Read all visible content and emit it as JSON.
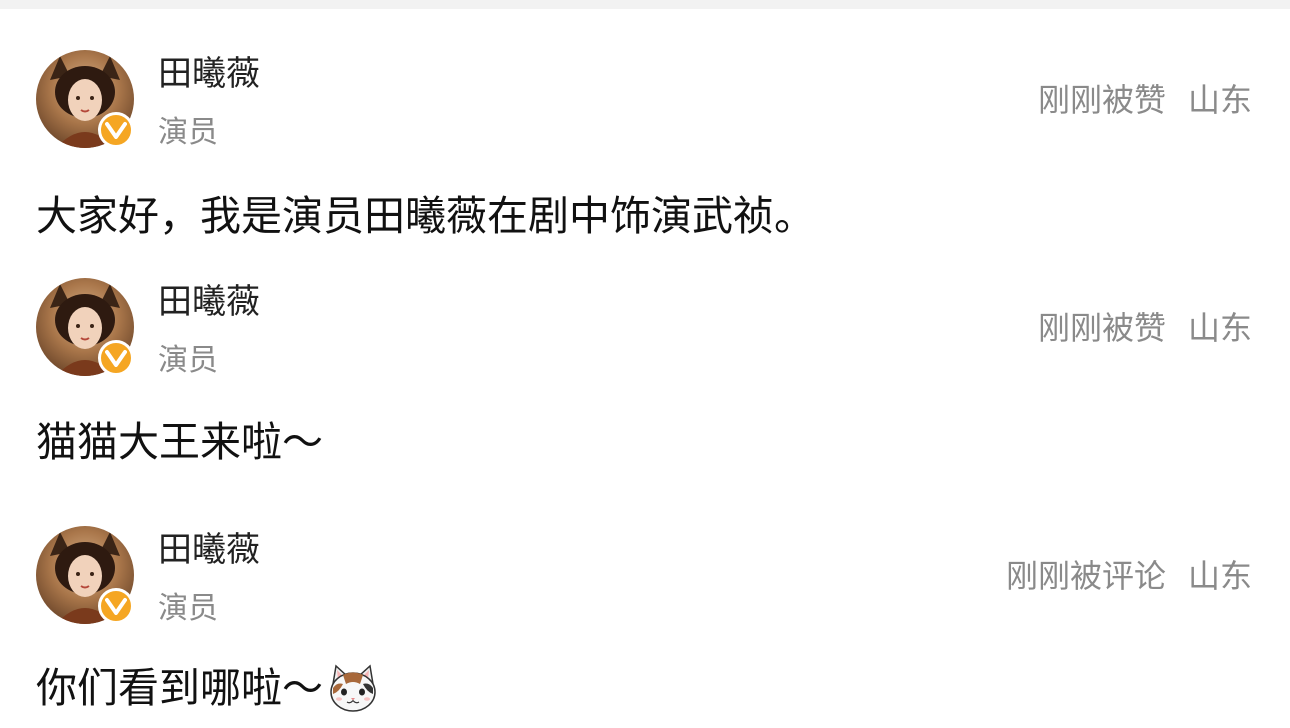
{
  "posts": [
    {
      "author": "田曦薇",
      "role": "演员",
      "status": "刚刚被赞",
      "location": "山东",
      "content": "大家好，我是演员田曦薇在剧中饰演武祯。"
    },
    {
      "author": "田曦薇",
      "role": "演员",
      "status": "刚刚被赞",
      "location": "山东",
      "content": "猫猫大王来啦～"
    },
    {
      "author": "田曦薇",
      "role": "演员",
      "status": "刚刚被评论",
      "location": "山东",
      "content": "你们看到哪啦～"
    }
  ],
  "colors": {
    "verified_badge": "#f5a623",
    "name_text": "#222222",
    "secondary_text": "#8a8a8a"
  },
  "icons": {
    "verified": "verified-v-icon",
    "emoji": "cat-face-emoji"
  }
}
